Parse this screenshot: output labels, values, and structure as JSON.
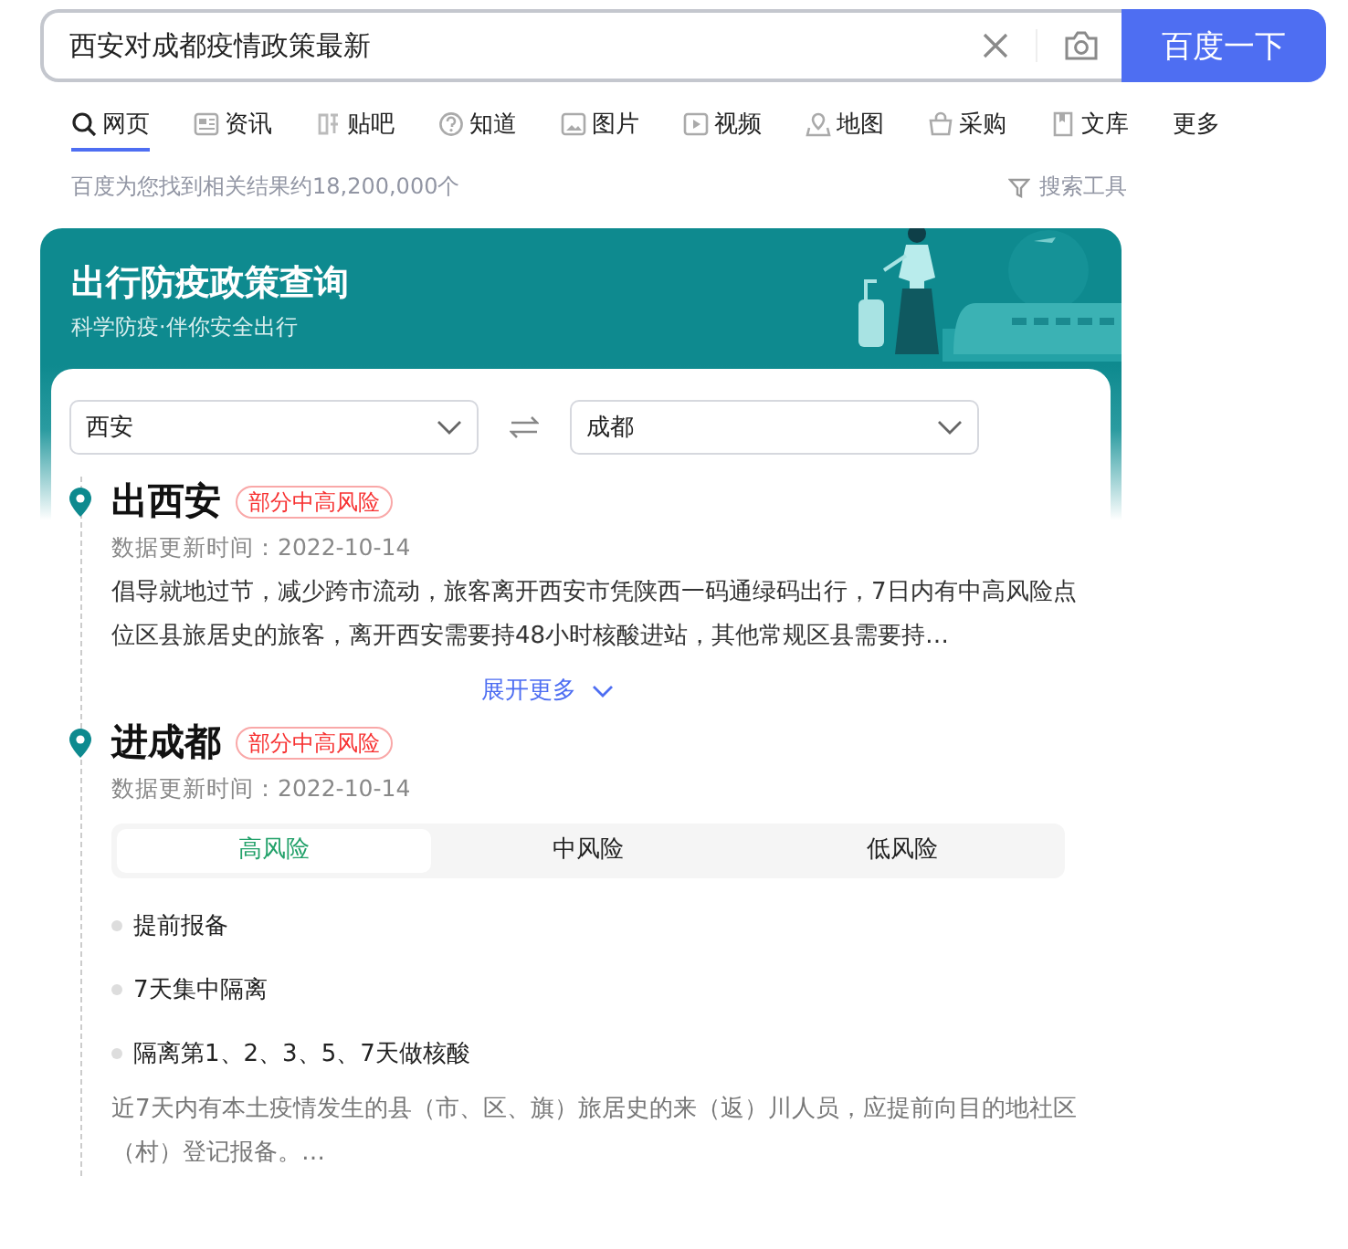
{
  "search": {
    "value": "西安对成都疫情政策最新",
    "button": "百度一下"
  },
  "tabs": [
    {
      "label": "网页",
      "kind": "search",
      "selected": true
    },
    {
      "label": "资讯",
      "kind": "news",
      "selected": false
    },
    {
      "label": "贴吧",
      "kind": "tieba",
      "selected": false
    },
    {
      "label": "知道",
      "kind": "question",
      "selected": false
    },
    {
      "label": "图片",
      "kind": "image",
      "selected": false
    },
    {
      "label": "视频",
      "kind": "video",
      "selected": false
    },
    {
      "label": "地图",
      "kind": "map",
      "selected": false
    },
    {
      "label": "采购",
      "kind": "basket",
      "selected": false
    },
    {
      "label": "文库",
      "kind": "doc",
      "selected": false
    },
    {
      "label": "更多",
      "kind": "more",
      "selected": false
    }
  ],
  "result_count": "百度为您找到相关结果约18,200,000个",
  "search_tools": "搜索工具",
  "card": {
    "title": "出行防疫政策查询",
    "subtitle": "科学防疫·伴你安全出行",
    "from": "西安",
    "to": "成都",
    "sections": [
      {
        "title": "出西安",
        "tag": "部分中高风险",
        "updated": "数据更新时间：2022-10-14",
        "text": "倡导就地过节，减少跨市流动，旅客离开西安市凭陕西一码通绿码出行，7日内有中高风险点位区县旅居史的旅客，离开西安需要持48小时核酸进站，其他常规区县需要持…",
        "more": "展开更多"
      },
      {
        "title": "进成都",
        "tag": "部分中高风险",
        "updated": "数据更新时间：2022-10-14",
        "risk_tabs": [
          {
            "label": "高风险",
            "selected": true
          },
          {
            "label": "中风险",
            "selected": false
          },
          {
            "label": "低风险",
            "selected": false
          }
        ],
        "items": [
          "提前报备",
          "7天集中隔离",
          "隔离第1、2、3、5、7天做核酸"
        ],
        "note": "近7天内有本土疫情发生的县（市、区、旗）旅居史的来（返）川人员，应提前向目的地社区（村）登记报备。…"
      }
    ]
  }
}
